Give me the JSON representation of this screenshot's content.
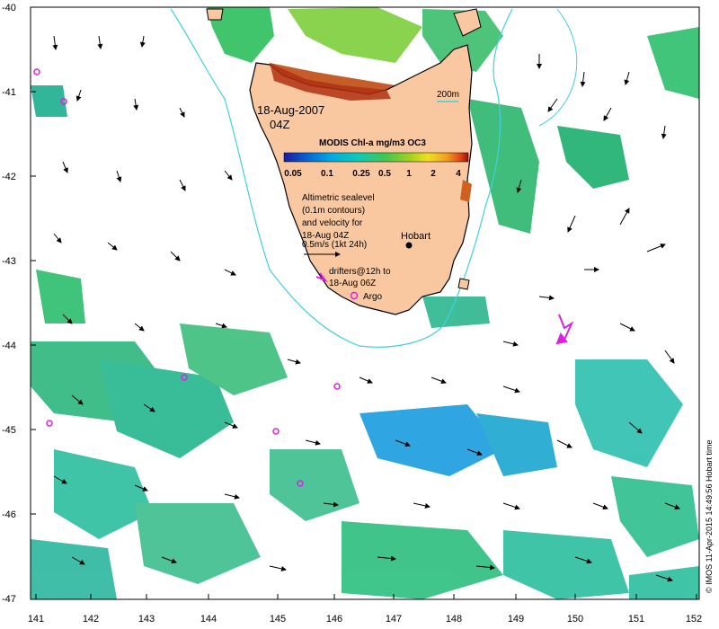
{
  "map": {
    "date_label": "18-Aug-2007",
    "time_label": "04Z",
    "colorbar_title": "MODIS Chl-a mg/m3 OC3",
    "colorbar_ticks": [
      "0.05",
      "0.1",
      "0.25",
      "0.5",
      "1",
      "2",
      "4"
    ],
    "colorbar_colors": [
      "#1a1aa0",
      "#0a5fd2",
      "#00a8e0",
      "#10c8b8",
      "#40c850",
      "#a0d020",
      "#f0e020",
      "#f0a020",
      "#e05018",
      "#a01010"
    ],
    "depth_label": "200m",
    "altimetry_note": [
      "Altimetric sealevel",
      "(0.1m contours)",
      "and velocity for",
      "18-Aug 04Z"
    ],
    "velocity_scale": "0.5m/s (1kt 24h)",
    "drifter_note": [
      "drifters@12h to",
      "18-Aug 06Z"
    ],
    "argo_label": "Argo",
    "city_label": "Hobart",
    "credit": "© IMOS 11-Apr-2015 14:49:56 Hobart time",
    "x_ticks": [
      "141",
      "142",
      "143",
      "144",
      "145",
      "146",
      "147",
      "148",
      "149",
      "150",
      "151",
      "152"
    ],
    "y_ticks": [
      "-40",
      "-41",
      "-42",
      "-43",
      "-44",
      "-45",
      "-46",
      "-47"
    ],
    "colors": {
      "land": "#fac8a0",
      "contour": "#40d0e0",
      "argo": "#e020e0",
      "drifter": "#e020e0",
      "chl_green": "#20c050",
      "chl_teal": "#20b8a0",
      "chl_blue": "#1e9ee0"
    }
  }
}
